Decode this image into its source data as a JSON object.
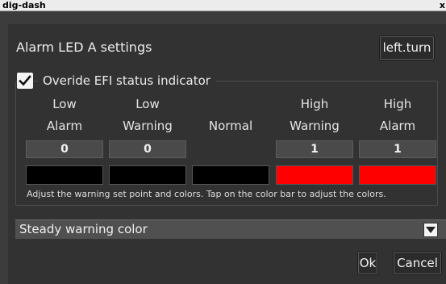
{
  "window": {
    "title": "dig-dash",
    "close_glyph": "x"
  },
  "dialog": {
    "heading": "Alarm LED A settings",
    "led_button_label": "left.turn",
    "override": {
      "label": "Overide EFI status indicator",
      "checked": true
    },
    "columns": [
      {
        "label_line1": "Low",
        "label_line2": "Alarm",
        "value": "0",
        "color": "#000000"
      },
      {
        "label_line1": "Low",
        "label_line2": "Warning",
        "value": "0",
        "color": "#000000"
      },
      {
        "label_line1": "",
        "label_line2": "Normal",
        "value": null,
        "color": "#000000"
      },
      {
        "label_line1": "High",
        "label_line2": "Warning",
        "value": "1",
        "color": "#ff0000"
      },
      {
        "label_line1": "High",
        "label_line2": "Alarm",
        "value": "1",
        "color": "#ff0000"
      }
    ],
    "hint": "Adjust the warning set point and colors. Tap on the color bar to adjust the colors.",
    "mode_select": {
      "selected": "Steady warning color"
    },
    "ok_label": "Ok",
    "cancel_label": "Cancel"
  },
  "colors": {
    "background": "#323232",
    "accent_red": "#ff0000"
  }
}
